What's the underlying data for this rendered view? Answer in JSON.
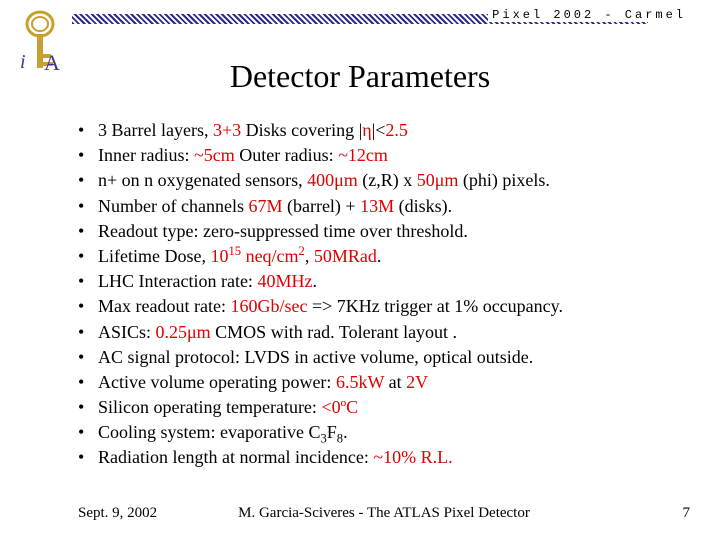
{
  "header": {
    "label": "Pixel 2002 - Carmel"
  },
  "title": "Detector Parameters",
  "bullets": [
    [
      {
        "t": "3 Barrel layers, ",
        "hl": false
      },
      {
        "t": "3+3",
        "hl": true
      },
      {
        "t": " Disks covering |",
        "hl": false
      },
      {
        "t": "η",
        "hl": true
      },
      {
        "t": "|<",
        "hl": false
      },
      {
        "t": "2.5",
        "hl": true
      }
    ],
    [
      {
        "t": "Inner radius:  ",
        "hl": false
      },
      {
        "t": "~5cm",
        "hl": true
      },
      {
        "t": "    Outer radius: ",
        "hl": false
      },
      {
        "t": "~12cm",
        "hl": true
      }
    ],
    [
      {
        "t": "n+ on n oxygenated sensors, ",
        "hl": false
      },
      {
        "t": "400μm",
        "hl": true
      },
      {
        "t": " (z,R) x ",
        "hl": false
      },
      {
        "t": "50μm",
        "hl": true
      },
      {
        "t": " (phi) pixels.",
        "hl": false
      }
    ],
    [
      {
        "t": "Number of channels ",
        "hl": false
      },
      {
        "t": "67M",
        "hl": true
      },
      {
        "t": " (barrel) + ",
        "hl": false
      },
      {
        "t": "13M",
        "hl": true
      },
      {
        "t": " (disks).",
        "hl": false
      }
    ],
    [
      {
        "t": "Readout type: zero-suppressed time over threshold.",
        "hl": false
      }
    ],
    [
      {
        "t": "Lifetime Dose, ",
        "hl": false
      },
      {
        "t": "10",
        "hl": true
      },
      {
        "t": "15",
        "hl": true,
        "sup": true
      },
      {
        "t": " neq/cm",
        "hl": true
      },
      {
        "t": "2",
        "hl": true,
        "sup": true
      },
      {
        "t": ",  ",
        "hl": false
      },
      {
        "t": "50MRad",
        "hl": true
      },
      {
        "t": ".",
        "hl": false
      }
    ],
    [
      {
        "t": "LHC Interaction rate: ",
        "hl": false
      },
      {
        "t": "40MHz",
        "hl": true
      },
      {
        "t": ".",
        "hl": false
      }
    ],
    [
      {
        "t": "Max readout rate: ",
        "hl": false
      },
      {
        "t": "160Gb/sec",
        "hl": true
      },
      {
        "t": " => 7KHz trigger at 1% occupancy.",
        "hl": false
      }
    ],
    [
      {
        "t": "ASICs: ",
        "hl": false
      },
      {
        "t": "0.25μm",
        "hl": true
      },
      {
        "t": " CMOS with rad. Tolerant layout .",
        "hl": false
      }
    ],
    [
      {
        "t": "AC signal protocol: LVDS in active volume, optical outside.",
        "hl": false
      }
    ],
    [
      {
        "t": "Active volume operating power: ",
        "hl": false
      },
      {
        "t": "6.5kW",
        "hl": true
      },
      {
        "t": " at ",
        "hl": false
      },
      {
        "t": "2V",
        "hl": true
      }
    ],
    [
      {
        "t": "Silicon operating temperature: ",
        "hl": false
      },
      {
        "t": "<0ºC",
        "hl": true
      }
    ],
    [
      {
        "t": "Cooling system: evaporative C",
        "hl": false
      },
      {
        "t": "3",
        "hl": false,
        "sub": true
      },
      {
        "t": "F",
        "hl": false
      },
      {
        "t": "8",
        "hl": false,
        "sub": true
      },
      {
        "t": ".",
        "hl": false
      }
    ],
    [
      {
        "t": "Radiation length at normal incidence: ",
        "hl": false
      },
      {
        "t": "~10% R.L.",
        "hl": true
      }
    ]
  ],
  "footer": {
    "date": "Sept. 9, 2002",
    "center": "M. Garcia-Sciveres   -   The ATLAS Pixel Detector",
    "page": "7"
  }
}
